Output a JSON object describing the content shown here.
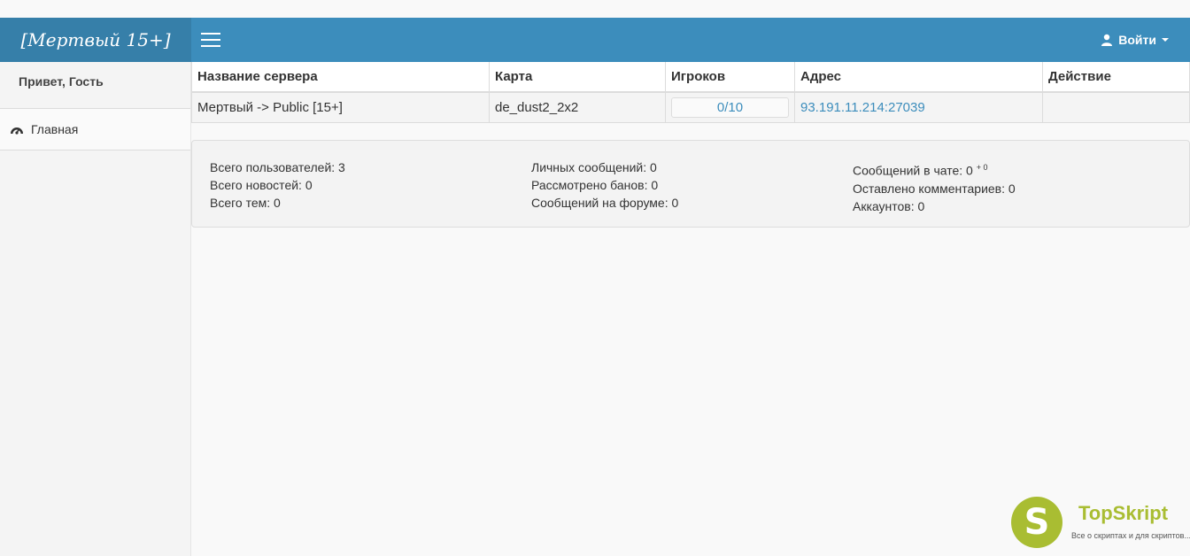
{
  "brand": "[Мертвый 15+]",
  "header": {
    "login_label": "Войти"
  },
  "sidebar": {
    "greeting": "Привет, Гость",
    "items": [
      {
        "label": "Главная",
        "icon": "dashboard-icon"
      }
    ]
  },
  "servers": {
    "columns": [
      "Название сервера",
      "Карта",
      "Игроков",
      "Адрес",
      "Действие"
    ],
    "rows": [
      {
        "name": "Мертвый -> Public [15+]",
        "map": "de_dust2_2x2",
        "players": "0/10",
        "address": "93.191.11.214:27039",
        "action": ""
      }
    ]
  },
  "stats": {
    "col1": [
      "Всего пользователей: 3",
      "Всего новостей: 0",
      "Всего тем: 0"
    ],
    "col2": [
      "Личных сообщений: 0",
      "Рассмотрено банов: 0",
      "Сообщений на форуме: 0"
    ],
    "col3": [
      "Сообщений в чате: 0",
      "Оставлено комментариев: 0",
      "Аккаунтов: 0"
    ],
    "chat_delta": "+ 0"
  },
  "watermark": {
    "name": "TopSkript",
    "tagline": "Все о скриптах и для скриптов...",
    "letter": "S"
  },
  "colors": {
    "accent": "#3c8dbc",
    "brand_bg": "#367fa9",
    "logo": "#a9bd32"
  }
}
